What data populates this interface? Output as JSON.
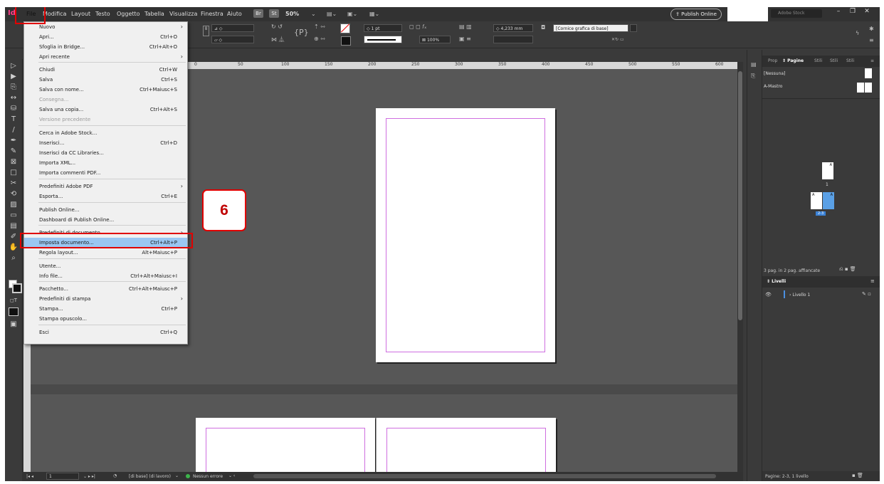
{
  "menubar": {
    "logo": "Id",
    "items": [
      "File",
      "Modifica",
      "Layout",
      "Testo",
      "Oggetto",
      "Tabella",
      "Visualizza",
      "Finestra",
      "Aiuto"
    ],
    "br": "Br",
    "st": "St",
    "zoom": "50%",
    "publish_online": "Publish Online",
    "search_placeholder": "Adobe Stock"
  },
  "control": {
    "stroke_weight": "1 pt",
    "dimension": "4,233 mm",
    "frame_style": "[Cornice grafica di base]",
    "scale": "100%"
  },
  "ruler": {
    "ticks": [
      "0",
      "50",
      "100",
      "150",
      "200",
      "250",
      "300",
      "350",
      "400",
      "450",
      "500",
      "550",
      "600"
    ]
  },
  "file_menu": {
    "items": [
      {
        "label": "Nuovo",
        "shortcut": "",
        "submenu": true,
        "disabled": false
      },
      {
        "label": "Apri...",
        "shortcut": "Ctrl+O",
        "submenu": false,
        "disabled": false
      },
      {
        "label": "Sfoglia in Bridge...",
        "shortcut": "Ctrl+Alt+O",
        "submenu": false,
        "disabled": false
      },
      {
        "label": "Apri recente",
        "shortcut": "",
        "submenu": true,
        "disabled": false
      },
      {
        "label": "Chiudi",
        "shortcut": "Ctrl+W",
        "submenu": false,
        "disabled": false
      },
      {
        "label": "Salva",
        "shortcut": "Ctrl+S",
        "submenu": false,
        "disabled": false
      },
      {
        "label": "Salva con nome...",
        "shortcut": "Ctrl+Maiusc+S",
        "submenu": false,
        "disabled": false
      },
      {
        "label": "Consegna...",
        "shortcut": "",
        "submenu": false,
        "disabled": true
      },
      {
        "label": "Salva una copia...",
        "shortcut": "Ctrl+Alt+S",
        "submenu": false,
        "disabled": false
      },
      {
        "label": "Versione precedente",
        "shortcut": "",
        "submenu": false,
        "disabled": true
      },
      {
        "label": "Cerca in Adobe Stock...",
        "shortcut": "",
        "submenu": false,
        "disabled": false
      },
      {
        "label": "Inserisci...",
        "shortcut": "Ctrl+D",
        "submenu": false,
        "disabled": false
      },
      {
        "label": "Inserisci da CC Libraries...",
        "shortcut": "",
        "submenu": false,
        "disabled": false
      },
      {
        "label": "Importa XML...",
        "shortcut": "",
        "submenu": false,
        "disabled": false
      },
      {
        "label": "Importa commenti PDF...",
        "shortcut": "",
        "submenu": false,
        "disabled": false
      },
      {
        "label": "Predefiniti Adobe PDF",
        "shortcut": "",
        "submenu": true,
        "disabled": false
      },
      {
        "label": "Esporta...",
        "shortcut": "Ctrl+E",
        "submenu": false,
        "disabled": false
      },
      {
        "label": "Publish Online...",
        "shortcut": "",
        "submenu": false,
        "disabled": false
      },
      {
        "label": "Dashboard di Publish Online...",
        "shortcut": "",
        "submenu": false,
        "disabled": false
      },
      {
        "label": "Predefiniti di documento",
        "shortcut": "",
        "submenu": true,
        "disabled": false
      },
      {
        "label": "Imposta documento...",
        "shortcut": "Ctrl+Alt+P",
        "submenu": false,
        "disabled": false,
        "highlighted": true
      },
      {
        "label": "Regola layout...",
        "shortcut": "Alt+Maiusc+P",
        "submenu": false,
        "disabled": false
      },
      {
        "label": "Utente...",
        "shortcut": "",
        "submenu": false,
        "disabled": false
      },
      {
        "label": "Info file...",
        "shortcut": "Ctrl+Alt+Maiusc+I",
        "submenu": false,
        "disabled": false
      },
      {
        "label": "Pacchetto...",
        "shortcut": "Ctrl+Alt+Maiusc+P",
        "submenu": false,
        "disabled": false
      },
      {
        "label": "Predefiniti di stampa",
        "shortcut": "",
        "submenu": true,
        "disabled": false
      },
      {
        "label": "Stampa...",
        "shortcut": "Ctrl+P",
        "submenu": false,
        "disabled": false
      },
      {
        "label": "Stampa opuscolo...",
        "shortcut": "",
        "submenu": false,
        "disabled": false
      },
      {
        "label": "Esci",
        "shortcut": "Ctrl+Q",
        "submenu": false,
        "disabled": false
      }
    ]
  },
  "step_badge": "6",
  "right_panel": {
    "tabs": [
      "Prop",
      "Pagine",
      "Stili",
      "Stili",
      "Stili"
    ],
    "none_master": "[Nessuna]",
    "a_master": "A-Mastro",
    "page1_label": "1",
    "spread_label": "2-3",
    "master_letter": "A",
    "pages_summary": "3 pag. in 2 pag. affiancate",
    "layers_title": "Livelli",
    "layer_name": "Livello 1",
    "footer": "Pagine: 2-3, 1 livello"
  },
  "status": {
    "page_field": "1",
    "master": "[di base] (di lavoro)",
    "errors": "Nessun errore"
  },
  "colors": {
    "accent_red": "#e00000",
    "highlight": "#9ac7f2",
    "margin_guide": "#cf6ee0",
    "selected_page": "#5aa0e6"
  }
}
